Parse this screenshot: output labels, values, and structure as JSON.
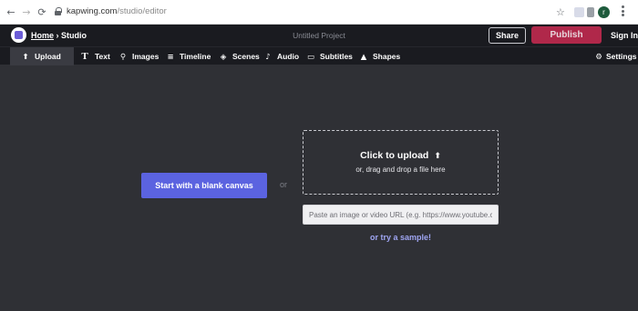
{
  "browser": {
    "back_icon": "arrow-left-icon",
    "forward_icon": "arrow-right-icon",
    "reload_icon": "reload-icon",
    "url_domain": "kapwing.com",
    "url_path": "/studio/editor",
    "avatar_letter": "r"
  },
  "header": {
    "crumb_home": "Home",
    "crumb_separator": "›",
    "crumb_current": "Studio",
    "project_title": "Untitled Project",
    "share_label": "Share",
    "publish_label": "Publish",
    "signin_label": "Sign In",
    "publish_color": "#b0284a"
  },
  "toolbar": {
    "upload": "Upload",
    "text": "Text",
    "images": "Images",
    "timeline": "Timeline",
    "scenes": "Scenes",
    "audio": "Audio",
    "subtitles": "Subtitles",
    "shapes": "Shapes",
    "settings": "Settings"
  },
  "main": {
    "blank_canvas_label": "Start with a blank canvas",
    "or_label": "or",
    "upload_title": "Click to upload",
    "upload_subtitle": "or, drag and drop a file here",
    "url_placeholder": "Paste an image or video URL (e.g. https://www.youtube.com/",
    "sample_link": "or try a sample!",
    "accent_color": "#5b63e0"
  }
}
